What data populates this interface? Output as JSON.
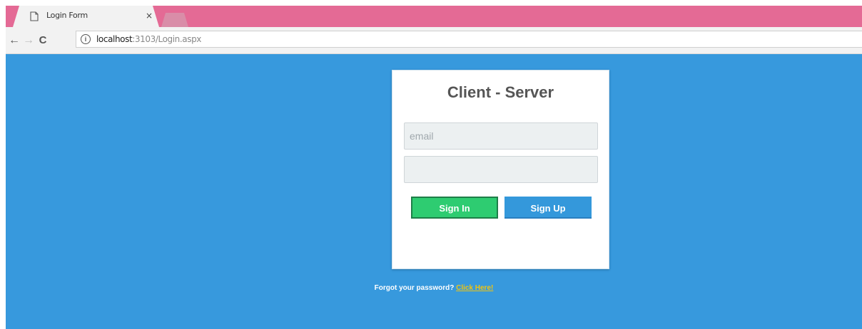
{
  "browser": {
    "tab": {
      "title": "Login Form",
      "close_glyph": "×",
      "page_icon": "document-icon"
    },
    "nav": {
      "back": "←",
      "forward": "→",
      "reload": "C"
    },
    "address_bar": {
      "info_glyph": "i",
      "host": "localhost",
      "path": ":3103/Login.aspx"
    }
  },
  "login": {
    "title": "Client - Server",
    "email_placeholder": "email",
    "email_value": "",
    "password_placeholder": "",
    "password_value": "",
    "signin_label": "Sign In",
    "signup_label": "Sign Up"
  },
  "footer": {
    "forgot_text": "Forgot your password?",
    "forgot_link": "Click Here!"
  },
  "colors": {
    "tab_strip": "#e46a95",
    "page_background": "#3799dd",
    "signin_button": "#2ecc71",
    "signup_button": "#3498db",
    "link": "#f1c40f",
    "title_text": "#555555"
  }
}
